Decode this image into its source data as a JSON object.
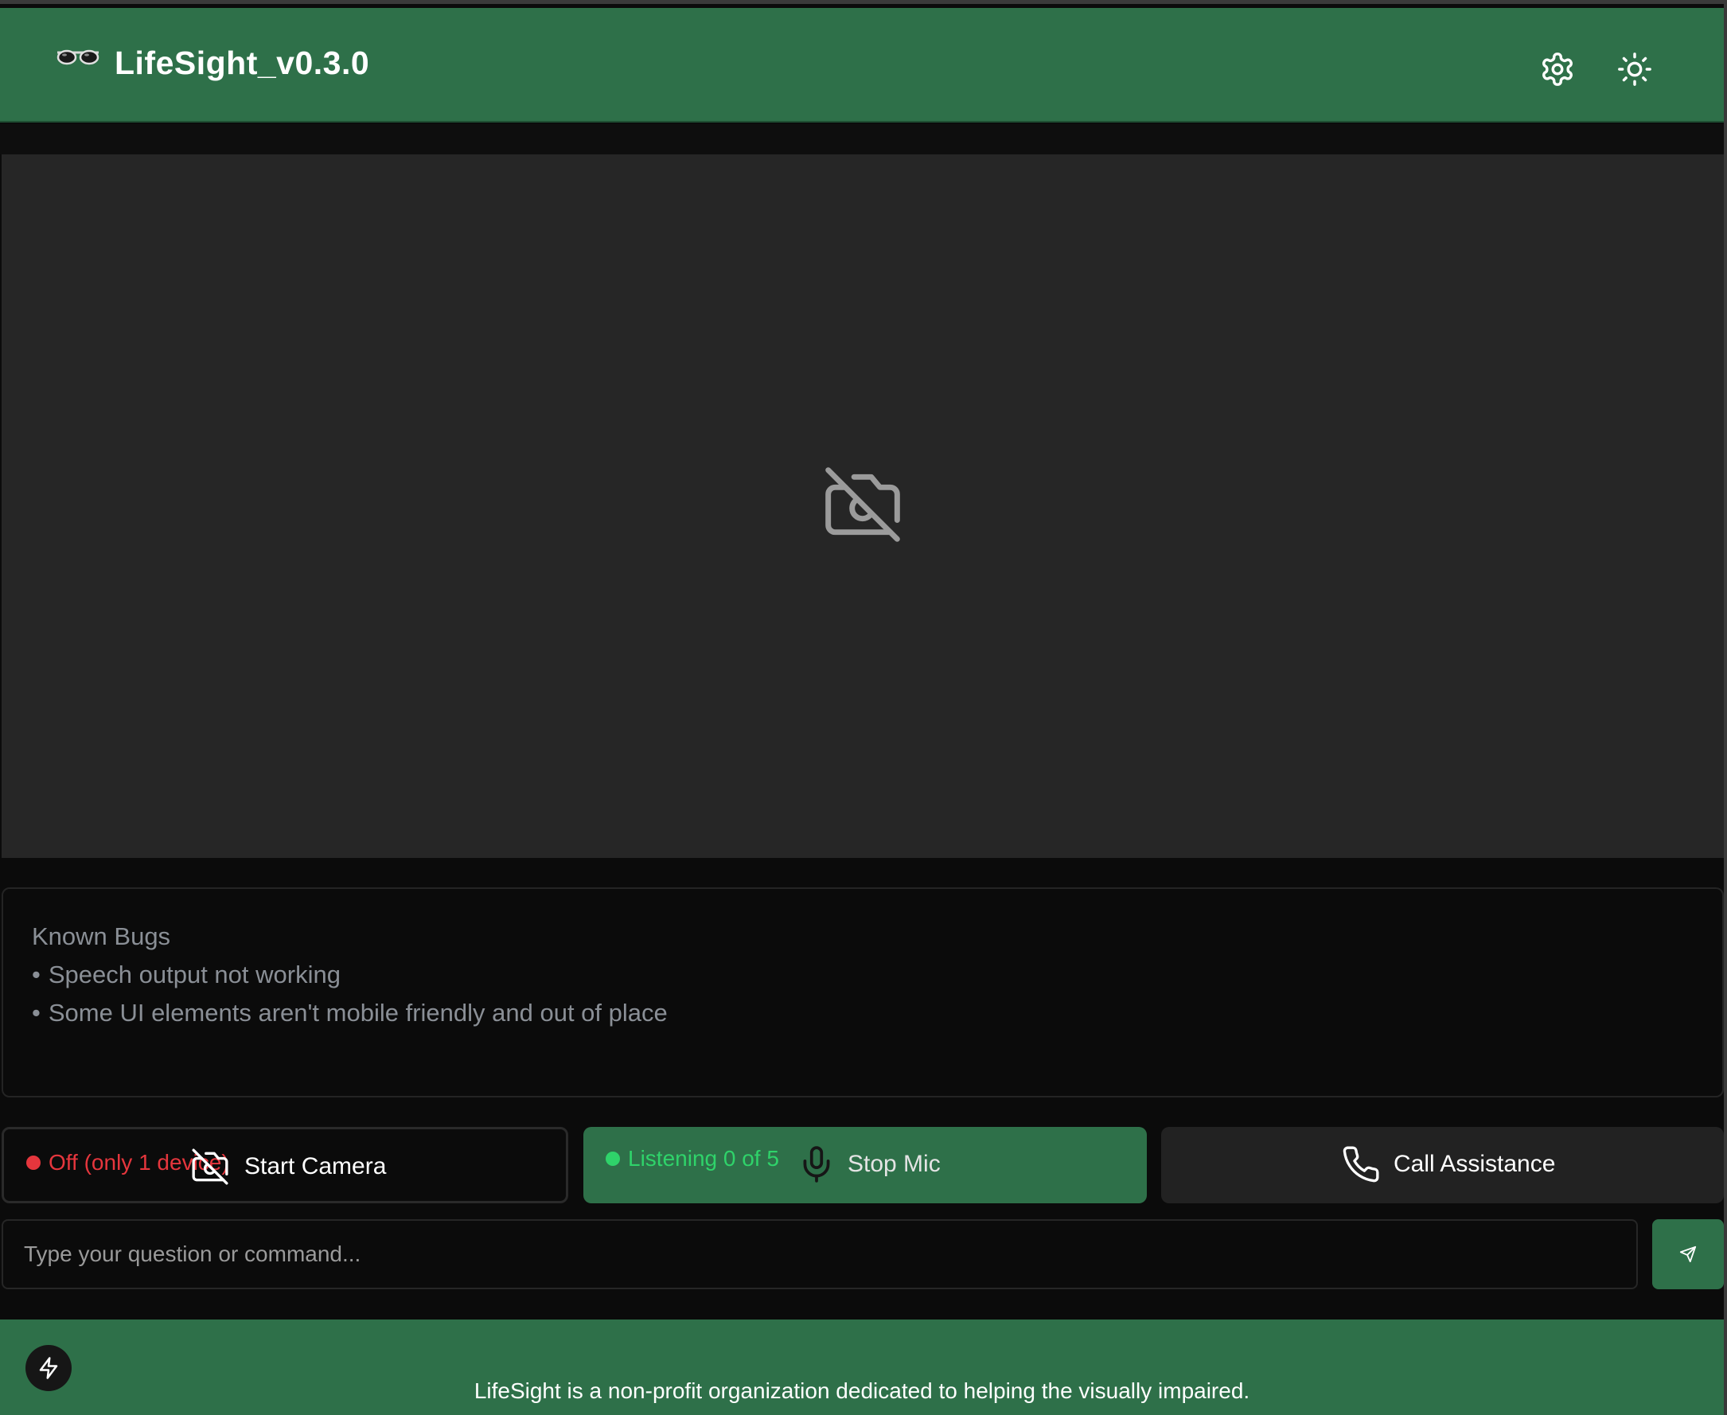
{
  "app": {
    "title": "LifeSight_v0.3.0",
    "logo_icon": "glasses-icon"
  },
  "header": {
    "settings_icon": "gear-icon",
    "theme_icon": "sun-icon"
  },
  "camera_view": {
    "status_icon": "camera-off-icon"
  },
  "known_bugs": {
    "heading": "Known Bugs",
    "items": [
      "Speech output not working",
      "Some UI elements aren't mobile friendly and out of place"
    ]
  },
  "controls": {
    "camera": {
      "status": "Off (only 1 device)",
      "label": "Start Camera",
      "icon": "camera-off-icon"
    },
    "mic": {
      "status": "Listening 0 of 5",
      "label": "Stop Mic",
      "icon": "microphone-icon"
    },
    "call": {
      "label": "Call Assistance",
      "icon": "phone-icon"
    }
  },
  "input": {
    "placeholder": "Type your question or command...",
    "value": "",
    "send_icon": "send-icon"
  },
  "footer": {
    "text": "LifeSight is a non-profit organization dedicated to helping the visually impaired.",
    "flash_icon": "lightning-icon"
  },
  "colors": {
    "brand_green": "#2e7049",
    "status_off": "#e5363d",
    "status_listening": "#2fd36a",
    "background": "#0b0b0b",
    "camera_bg": "#262626"
  }
}
